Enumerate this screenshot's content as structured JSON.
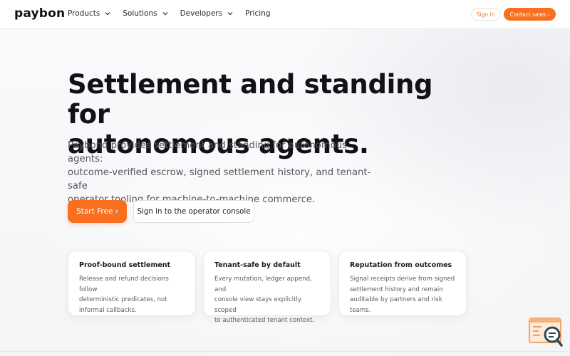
{
  "brand": {
    "logo_text": "paybon"
  },
  "nav": {
    "items": [
      {
        "label": "Products",
        "has_dropdown": true
      },
      {
        "label": "Solutions",
        "has_dropdown": true
      },
      {
        "label": "Developers",
        "has_dropdown": true
      },
      {
        "label": "Pricing",
        "has_dropdown": false
      }
    ],
    "signin_label": "Sign in",
    "contact_label": "Contact sales ›"
  },
  "hero": {
    "title_line1": "Settlement and standing for",
    "title_line2": "autonomous agents.",
    "subtitle_line1": "Paybond provides settlement and standing for autonomous agents:",
    "subtitle_line2": "outcome-verified escrow, signed settlement history, and tenant-safe",
    "subtitle_line3": "operator tooling for machine-to-machine commerce.",
    "primary_cta": "Start Free ›",
    "secondary_cta": "Sign in to the operator console"
  },
  "cards": [
    {
      "title": "Proof-bound settlement",
      "lines": [
        "Release and refund decisions follow",
        "deterministic predicates, not",
        "informal callbacks."
      ]
    },
    {
      "title": "Tenant-safe by default",
      "lines": [
        "Every mutation, ledger append, and",
        "console view stays explicitly scoped",
        "to authenticated tenant context."
      ]
    },
    {
      "title": "Reputation from outcomes",
      "lines": [
        "Signal receipts derive from signed",
        "settlement history and remain",
        "auditable by partners and risk teams."
      ]
    }
  ],
  "widget": {
    "icon": "chat-search-icon"
  },
  "colors": {
    "accent": "#f8701f",
    "text_dark": "#111116",
    "text_muted": "#55565d"
  }
}
